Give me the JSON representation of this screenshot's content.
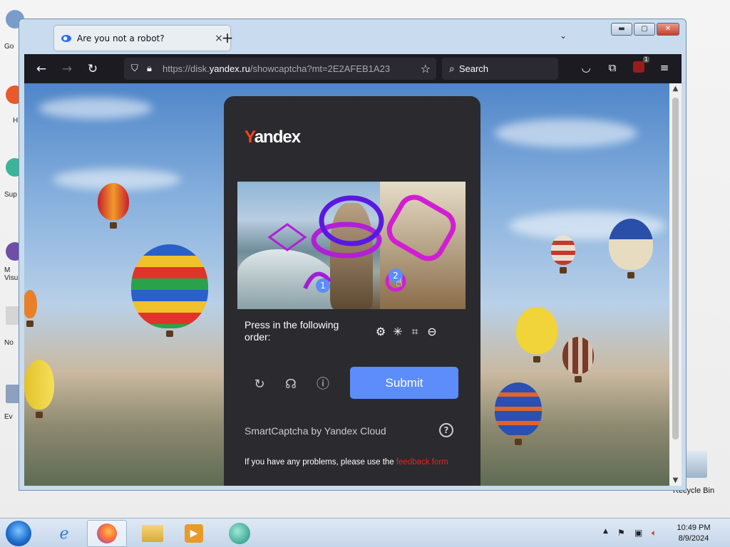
{
  "desktop": {
    "icons": [
      {
        "label": "Go",
        "color": "#7a9cc9"
      },
      {
        "label": "H",
        "color": "#e85a2a"
      },
      {
        "label": "Sup",
        "color": "#3bb59a"
      },
      {
        "label": "M Visu",
        "color": "#6f4ea8"
      },
      {
        "label": "No",
        "color": "#d5d5d5"
      },
      {
        "label": "Ev",
        "color": "#8da0c0"
      }
    ],
    "recycle_bin_label": "Recycle Bin"
  },
  "browser": {
    "tab_title": "Are you not a robot?",
    "tab_close": "×",
    "new_tab": "+",
    "tab_list": "⌄",
    "window_buttons": {
      "minimize": "▬",
      "maximize": "▢",
      "close": "✕"
    },
    "nav": {
      "back": "←",
      "forward": "→",
      "reload": "↻"
    },
    "url": {
      "prefix": "https://disk.",
      "domain": "yandex.ru",
      "path": "/showcaptcha?mt=2E2AFEB1A23"
    },
    "search_placeholder": "Search",
    "extension_badge": "1"
  },
  "captcha": {
    "logo_y": "Y",
    "logo_rest": "andex",
    "prompt": "Press in the following order:",
    "order_icons": [
      "⚙",
      "✳",
      "⌗",
      "⊖"
    ],
    "submit_label": "Submit",
    "brand": "SmartCaptcha by Yandex Cloud",
    "help": "?",
    "problem_text": "If you have any problems, please use the ",
    "problem_link": "feedback form",
    "markers": [
      "1",
      "2"
    ]
  },
  "taskbar": {
    "clock_time": "10:49 PM",
    "clock_date": "8/9/2024"
  },
  "colors": {
    "captcha_bg": "#2b2b2f",
    "submit": "#5c8dfa",
    "link": "#e7201f",
    "browser_toolbar": "#1c1b22"
  }
}
